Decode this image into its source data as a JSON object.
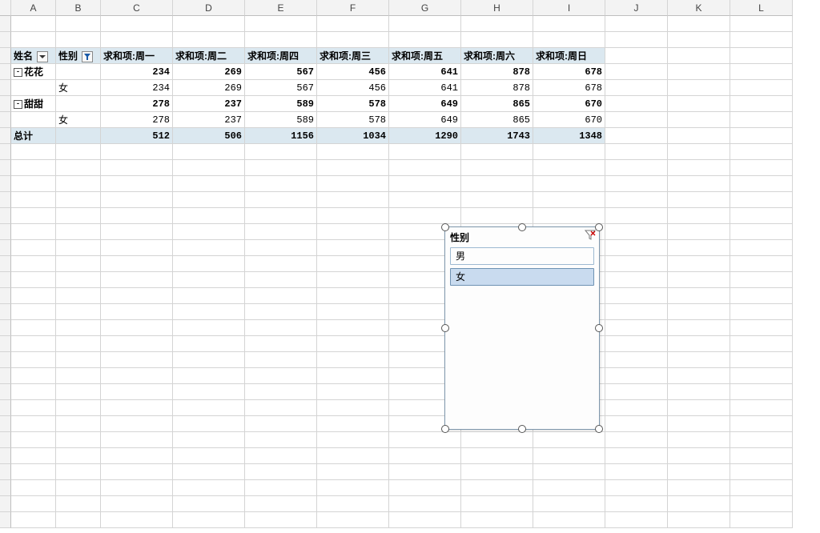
{
  "columns": [
    "A",
    "B",
    "C",
    "D",
    "E",
    "F",
    "G",
    "H",
    "I",
    "J",
    "K",
    "L"
  ],
  "pivot": {
    "name_label": "姓名",
    "gender_label": "性别",
    "day_headers": [
      "求和项:周一",
      "求和项:周二",
      "求和项:周四",
      "求和项:周三",
      "求和项:周五",
      "求和项:周六",
      "求和项:周日"
    ],
    "rows": [
      {
        "name": "花花",
        "collapse": "-",
        "values": [
          234,
          269,
          567,
          456,
          641,
          878,
          678
        ]
      },
      {
        "gender": "女",
        "values": [
          234,
          269,
          567,
          456,
          641,
          878,
          678
        ]
      },
      {
        "name": "甜甜",
        "collapse": "-",
        "values": [
          278,
          237,
          589,
          578,
          649,
          865,
          670
        ]
      },
      {
        "gender": "女",
        "values": [
          278,
          237,
          589,
          578,
          649,
          865,
          670
        ]
      }
    ],
    "total_label": "总计",
    "totals": [
      512,
      506,
      1156,
      1034,
      1290,
      1743,
      1348
    ]
  },
  "slicer": {
    "title": "性别",
    "items": [
      {
        "label": "男",
        "selected": false
      },
      {
        "label": "女",
        "selected": true
      }
    ]
  }
}
